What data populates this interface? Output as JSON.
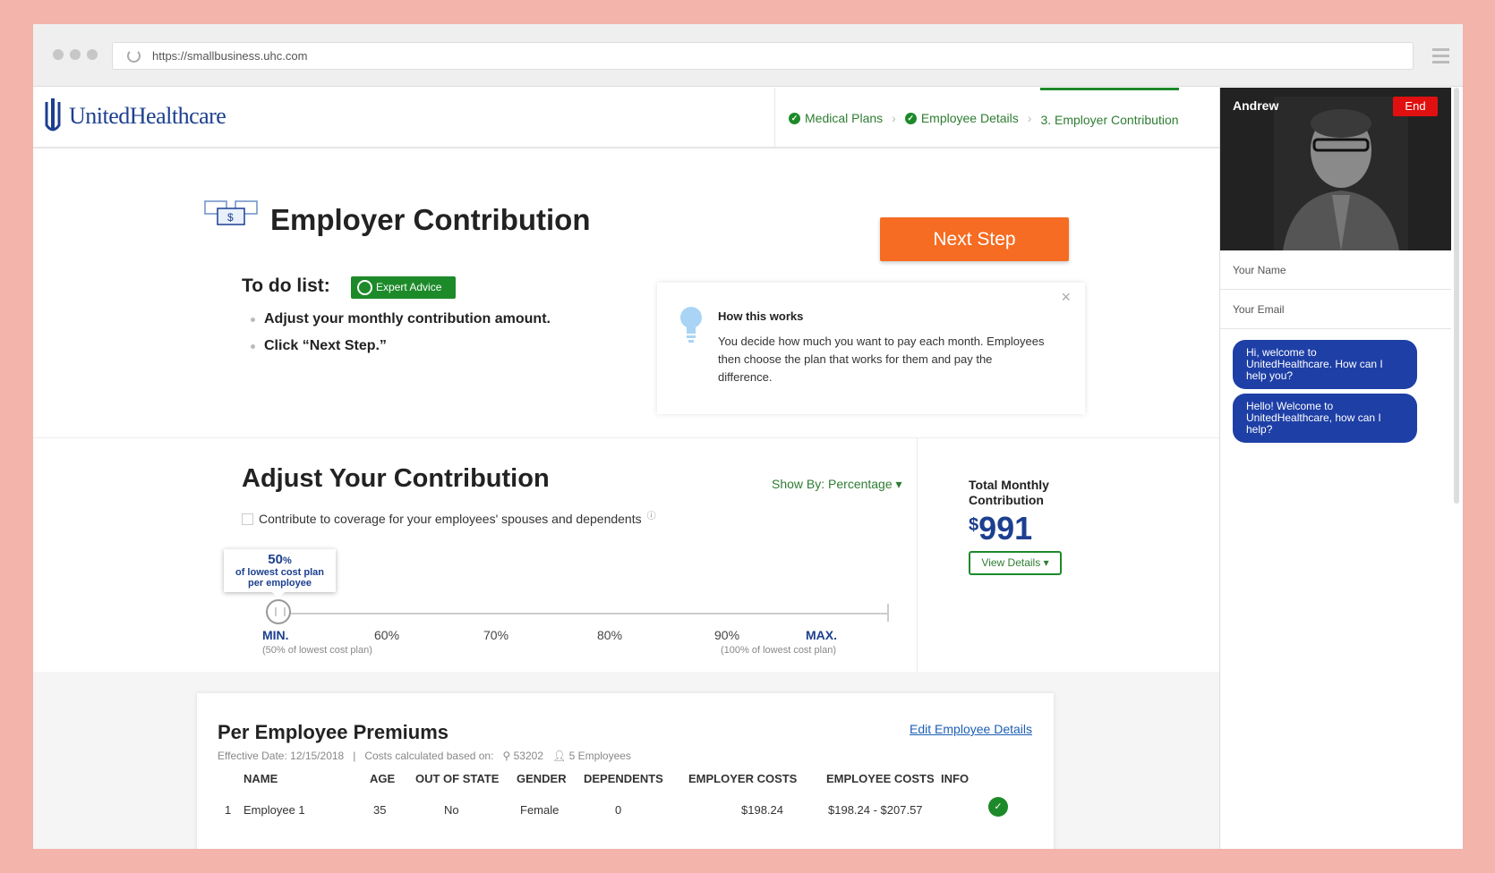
{
  "browser": {
    "url": "https://smallbusiness.uhc.com"
  },
  "header": {
    "logo_text": "UnitedHealthcare",
    "steps": [
      {
        "label": "Medical Plans",
        "done": true
      },
      {
        "label": "Employee Details",
        "done": true
      },
      {
        "label": "3. Employer Contribution",
        "active": true
      }
    ]
  },
  "hero": {
    "title": "Employer Contribution",
    "next_button": "Next Step",
    "todo_label": "To do list:",
    "expert_badge": "Expert Advice",
    "todo_items": [
      "Adjust your monthly contribution amount.",
      "Click “Next Step.”"
    ]
  },
  "how_it_works": {
    "title": "How this works",
    "body": "You decide how much you want to pay each month. Employees then choose the plan that works for them and pay the difference."
  },
  "adjust": {
    "title": "Adjust Your Contribution",
    "show_by": "Show By: Percentage",
    "checkbox_label": "Contribute to coverage for your employees' spouses and dependents",
    "tooltip_pct": "50",
    "tooltip_pct_suffix": "%",
    "tooltip_line1": "of lowest cost plan",
    "tooltip_line2": "per employee",
    "slider_value_percent": 50,
    "ticks": {
      "min": "MIN.",
      "t60": "60%",
      "t70": "70%",
      "t80": "80%",
      "t90": "90%",
      "max": "MAX."
    },
    "min_sub": "(50% of lowest cost plan)",
    "max_sub": "(100% of lowest cost plan)"
  },
  "total": {
    "label": "Total Monthly Contribution",
    "currency": "$",
    "value": "991",
    "view_details": "View Details"
  },
  "premiums": {
    "title": "Per Employee Premiums",
    "edit_link": "Edit Employee Details",
    "effective": "Effective Date: 12/15/2018",
    "costs_based": "Costs calculated based on:",
    "zip": "53202",
    "employees": "5 Employees",
    "columns": [
      "NAME",
      "AGE",
      "OUT OF STATE",
      "GENDER",
      "DEPENDENTS",
      "EMPLOYER COSTS",
      "EMPLOYEE COSTS",
      "INFO"
    ],
    "rows": [
      {
        "num": "1",
        "name": "Employee 1",
        "age": "35",
        "out_of_state": "No",
        "gender": "Female",
        "dependents": "0",
        "employer_costs": "$198.24",
        "employee_costs": "$198.24 - $207.57"
      }
    ]
  },
  "chat": {
    "agent_name": "Andrew",
    "end_button": "End",
    "name_placeholder": "Your Name",
    "email_placeholder": "Your Email",
    "messages": [
      "Hi, welcome to UnitedHealthcare. How can I help you?",
      "Hello! Welcome to UnitedHealthcare, how can I help?"
    ]
  },
  "colors": {
    "brand_blue": "#1c3f8f",
    "green": "#1d8a2a",
    "orange": "#f56c22",
    "chat_blue": "#1e3fa6"
  }
}
